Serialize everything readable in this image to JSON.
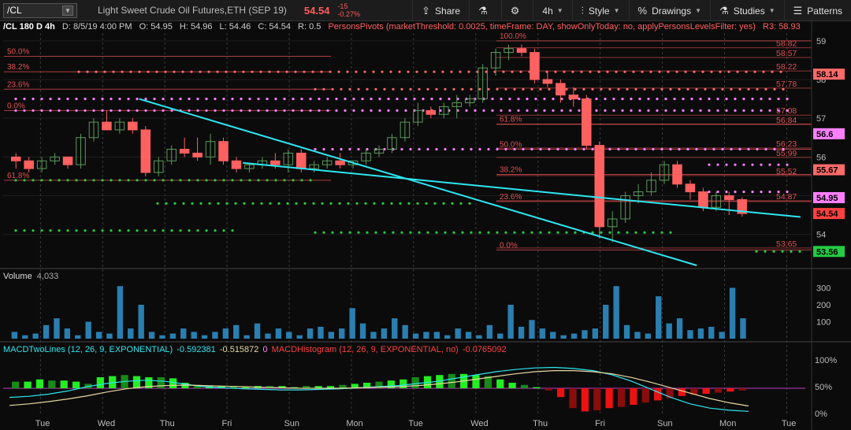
{
  "toolbar": {
    "symbol": "/CL",
    "description": "Light Sweet Crude Oil Futures,ETH (SEP 19)",
    "last": "54.54",
    "change": "-15",
    "change_pct": "-0.27%",
    "share": "Share",
    "timeframe": "4h",
    "style": "Style",
    "drawings": "Drawings",
    "studies": "Studies",
    "patterns": "Patterns"
  },
  "header": {
    "title": "/CL 180 D 4h",
    "date": "D: 8/5/19 4:00 PM",
    "open": "O: 54.95",
    "high": "H: 54.96",
    "low": "L: 54.46",
    "close": "C: 54.54",
    "range": "R: 0.5",
    "study": "PersonsPivots (marketThreshold: 0.0025, timeFrame: DAY, showOnlyToday: no, applyPersonsLevelsFilter: yes)",
    "r3": "R3: 58.93"
  },
  "volume_header": {
    "label": "Volume",
    "value": "4,033"
  },
  "macd_header": {
    "lines_label": "MACDTwoLines (12, 26, 9, EXPONENTIAL)",
    "value": "-0.592381",
    "avg": "-0.515872",
    "zero": "0",
    "hist_label": "MACDHistogram (12, 26, 9, EXPONENTIAL, no)",
    "hist_value": "-0.0765092"
  },
  "colors": {
    "up": "#5a9a5a",
    "down": "#ff6060",
    "trend": "#2ee6f0",
    "fib": "#e05050",
    "volume": "#2a7fb0",
    "hist_up": "#22ee22",
    "hist_down": "#ee1111"
  },
  "chart_data": [
    {
      "type": "candlestick",
      "price_axis": [
        "59",
        "58",
        "57",
        "56",
        "55",
        "54"
      ],
      "x_labels": [
        "Tue",
        "Wed",
        "Thu",
        "Fri",
        "Sun",
        "Mon",
        "Tue",
        "Wed",
        "Thu",
        "Fri",
        "Sun",
        "Mon",
        "Tue"
      ],
      "ylim": [
        53.2,
        59.2
      ],
      "fib_levels": [
        {
          "label": "100.0%",
          "price": 59.0
        },
        {
          "label": "61.8%",
          "price": 56.85
        },
        {
          "label": "50.0%",
          "price": 56.2
        },
        {
          "label": "38.2%",
          "price": 55.55
        },
        {
          "label": "23.6%",
          "price": 54.85
        },
        {
          "label": "0.0%",
          "price": 53.6
        },
        {
          "label": "50.0%",
          "price": 58.6
        },
        {
          "label": "38.2%",
          "price": 58.2
        },
        {
          "label": "23.6%",
          "price": 57.75
        },
        {
          "label": "0.0%",
          "price": 57.2
        },
        {
          "label": "61.8%",
          "price": 55.4
        }
      ],
      "right_levels": [
        "58.82",
        "58.57",
        "58.22",
        "57.78",
        "57.08",
        "56.84",
        "56.23",
        "55.99",
        "55.52",
        "54.87",
        "53.65"
      ],
      "right_tags": [
        {
          "value": "58.14",
          "color": "#ff6a6a",
          "price": 58.14
        },
        {
          "value": "56.6",
          "color": "#ff80ff",
          "price": 56.6
        },
        {
          "value": "55.67",
          "color": "#ff6a6a",
          "price": 55.67
        },
        {
          "value": "54.95",
          "color": "#ff80ff",
          "price": 54.95
        },
        {
          "value": "54.54",
          "color": "#ff4040",
          "price": 54.54
        },
        {
          "value": "53.56",
          "color": "#22cc44",
          "price": 53.56
        }
      ],
      "candles": [
        [
          56.0,
          56.1,
          55.7,
          55.9
        ],
        [
          55.9,
          56.0,
          55.6,
          55.7
        ],
        [
          55.7,
          56.0,
          55.6,
          55.9
        ],
        [
          55.9,
          56.1,
          55.8,
          56.0
        ],
        [
          56.0,
          56.0,
          55.7,
          55.8
        ],
        [
          55.8,
          56.6,
          55.7,
          56.5
        ],
        [
          56.5,
          57.0,
          56.4,
          56.9
        ],
        [
          56.9,
          57.2,
          56.7,
          56.7
        ],
        [
          56.7,
          57.0,
          56.6,
          56.9
        ],
        [
          56.9,
          57.0,
          56.6,
          56.7
        ],
        [
          56.7,
          56.8,
          55.5,
          55.6
        ],
        [
          55.6,
          56.0,
          55.5,
          55.9
        ],
        [
          55.9,
          56.3,
          55.8,
          56.2
        ],
        [
          56.2,
          56.5,
          56.0,
          56.1
        ],
        [
          56.1,
          56.5,
          55.9,
          56.0
        ],
        [
          56.0,
          56.6,
          55.8,
          56.4
        ],
        [
          56.4,
          56.5,
          55.8,
          55.9
        ],
        [
          55.9,
          56.0,
          55.6,
          55.7
        ],
        [
          55.7,
          55.8,
          55.6,
          55.8
        ],
        [
          55.8,
          56.0,
          55.7,
          55.9
        ],
        [
          55.9,
          56.1,
          55.7,
          55.8
        ],
        [
          55.8,
          56.2,
          55.6,
          56.1
        ],
        [
          56.1,
          56.2,
          55.6,
          55.7
        ],
        [
          55.7,
          55.9,
          55.6,
          55.8
        ],
        [
          55.8,
          56.0,
          55.7,
          55.9
        ],
        [
          55.9,
          56.1,
          55.7,
          55.8
        ],
        [
          55.8,
          55.9,
          55.7,
          55.9
        ],
        [
          55.9,
          56.2,
          55.8,
          56.1
        ],
        [
          56.1,
          56.3,
          56.0,
          56.2
        ],
        [
          56.2,
          56.6,
          56.1,
          56.5
        ],
        [
          56.5,
          57.0,
          56.4,
          56.9
        ],
        [
          56.9,
          57.4,
          56.8,
          57.2
        ],
        [
          57.2,
          57.3,
          57.0,
          57.1
        ],
        [
          57.1,
          57.4,
          57.0,
          57.3
        ],
        [
          57.3,
          57.6,
          57.0,
          57.4
        ],
        [
          57.4,
          57.6,
          57.3,
          57.5
        ],
        [
          57.5,
          58.4,
          57.4,
          58.3
        ],
        [
          58.3,
          58.8,
          58.1,
          58.7
        ],
        [
          58.7,
          58.9,
          58.5,
          58.8
        ],
        [
          58.8,
          58.9,
          58.6,
          58.7
        ],
        [
          58.7,
          58.8,
          57.9,
          58.0
        ],
        [
          58.0,
          58.2,
          57.8,
          57.9
        ],
        [
          57.9,
          58.0,
          57.4,
          57.6
        ],
        [
          57.6,
          57.8,
          57.3,
          57.5
        ],
        [
          57.5,
          57.6,
          56.2,
          56.3
        ],
        [
          56.3,
          56.4,
          53.9,
          54.2
        ],
        [
          54.2,
          54.6,
          53.8,
          54.4
        ],
        [
          54.4,
          55.1,
          54.3,
          55.0
        ],
        [
          55.0,
          55.3,
          54.8,
          55.1
        ],
        [
          55.1,
          55.6,
          55.0,
          55.4
        ],
        [
          55.4,
          55.9,
          55.3,
          55.8
        ],
        [
          55.8,
          55.9,
          55.2,
          55.3
        ],
        [
          55.3,
          55.4,
          54.9,
          55.1
        ],
        [
          55.1,
          55.2,
          54.6,
          54.7
        ],
        [
          54.7,
          55.1,
          54.6,
          55.0
        ],
        [
          55.0,
          55.1,
          54.5,
          54.9
        ],
        [
          54.9,
          54.96,
          54.46,
          54.54
        ]
      ],
      "trendlines": [
        {
          "from": [
            10,
            57.5
          ],
          "to": [
            53,
            53.2
          ]
        },
        {
          "from": [
            18,
            55.85
          ],
          "to": [
            61,
            54.45
          ]
        }
      ]
    },
    {
      "type": "bar",
      "title": "Volume",
      "y_axis": [
        "300",
        "200",
        "100"
      ],
      "ylim": [
        0,
        330
      ],
      "values": [
        40,
        20,
        30,
        80,
        120,
        60,
        20,
        100,
        40,
        30,
        310,
        60,
        200,
        40,
        20,
        30,
        60,
        40,
        20,
        40,
        60,
        80,
        20,
        90,
        30,
        60,
        40,
        20,
        60,
        70,
        40,
        60,
        180,
        90,
        40,
        60,
        120,
        80,
        30,
        40,
        40,
        20,
        60,
        40,
        20,
        80,
        30,
        200,
        70,
        110,
        60,
        40,
        20,
        30,
        50,
        60,
        200,
        310,
        80,
        40,
        30,
        250,
        90,
        120,
        50,
        60,
        70,
        40,
        300,
        120
      ]
    },
    {
      "type": "bar",
      "title": "MACDHistogram",
      "y_axis": [
        "100%",
        "50%",
        "0%"
      ],
      "values": [
        0.3,
        0.3,
        0.4,
        0.35,
        0.35,
        0.3,
        0.2,
        0.5,
        0.55,
        0.6,
        0.55,
        0.5,
        0.5,
        0.45,
        0.25,
        0.15,
        0.1,
        0.1,
        0.1,
        0.05,
        0.1,
        0.1,
        0.1,
        0.05,
        0.1,
        0.1,
        0.1,
        0.15,
        0.2,
        0.25,
        0.3,
        0.35,
        0.4,
        0.5,
        0.55,
        0.6,
        0.65,
        0.65,
        0.6,
        0.55,
        0.4,
        0.25,
        0.15,
        0.05,
        -0.1,
        -0.4,
        -0.9,
        -1.05,
        -1.0,
        -0.9,
        -0.85,
        -0.75,
        -0.65,
        -0.55,
        -0.45,
        -0.35,
        -0.3,
        -0.25,
        -0.2,
        -0.15,
        -0.1
      ],
      "lines": {
        "value": [
          0.3,
          0.32,
          0.36,
          0.42,
          0.5,
          0.56,
          0.6,
          0.62,
          0.6,
          0.55,
          0.5,
          0.48,
          0.46,
          0.45,
          0.44,
          0.44,
          0.45,
          0.46,
          0.48,
          0.5,
          0.52,
          0.56,
          0.6,
          0.66,
          0.72,
          0.78,
          0.82,
          0.85,
          0.86,
          0.84,
          0.8,
          0.72,
          0.6,
          0.45,
          0.3,
          0.18,
          0.1,
          0.06,
          0.04
        ],
        "avg": [
          0.15,
          0.18,
          0.22,
          0.27,
          0.33,
          0.4,
          0.46,
          0.5,
          0.52,
          0.53,
          0.52,
          0.51,
          0.5,
          0.49,
          0.48,
          0.47,
          0.47,
          0.47,
          0.48,
          0.49,
          0.5,
          0.52,
          0.55,
          0.59,
          0.64,
          0.69,
          0.74,
          0.78,
          0.8,
          0.8,
          0.78,
          0.74,
          0.67,
          0.58,
          0.48,
          0.38,
          0.28,
          0.2,
          0.14
        ]
      }
    }
  ]
}
